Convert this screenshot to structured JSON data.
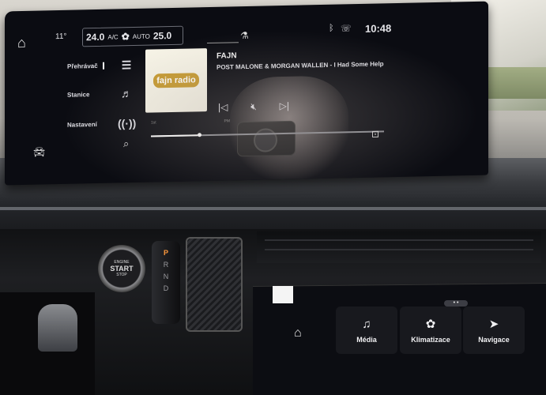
{
  "status_bar": {
    "outside_temp": "11°",
    "driver_temp": "24.0",
    "ac_label": "A/C",
    "auto_label": "AUTO",
    "passenger_temp": "25.0",
    "clock": "10:48"
  },
  "sidebar": {
    "items": [
      {
        "label": "Přehrávač",
        "icon": "menu-icon"
      },
      {
        "label": "Stanice",
        "icon": "radio-list-icon"
      },
      {
        "label": "Nastavení",
        "icon": "antenna-icon"
      }
    ]
  },
  "now_playing": {
    "station_logo": "fajn radio",
    "station": "FAJN",
    "track": "POST MALONE & MORGAN WALLEN - I Had Some Help",
    "tick_left": "1st",
    "tick_right": "PM",
    "progress": 0.2
  },
  "console": {
    "engine_line1": "ENGINE",
    "engine_line2": "START",
    "engine_line3": "STOP",
    "gears": [
      "P",
      "R",
      "N",
      "D"
    ]
  },
  "touchbar": {
    "tiles": [
      {
        "label": "Média",
        "icon": "music-note-icon"
      },
      {
        "label": "Klimatizace",
        "icon": "fan-icon"
      },
      {
        "label": "Navigace",
        "icon": "navigation-arrow-icon"
      }
    ],
    "page_indicator": "• •"
  },
  "colors": {
    "gear_active": "#ff9a3c",
    "logo_accent": "#c79a2f"
  }
}
